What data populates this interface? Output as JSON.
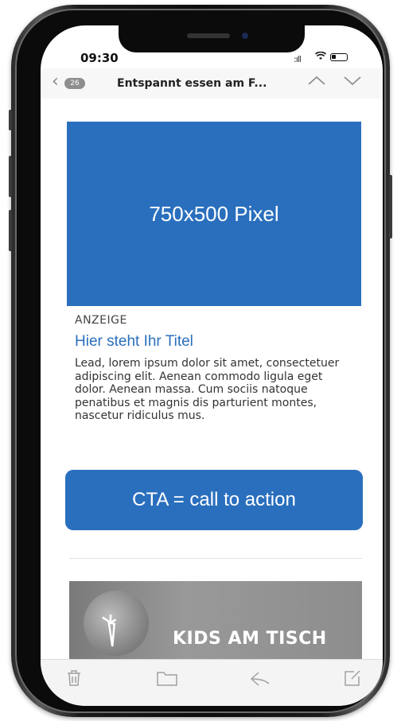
{
  "status": {
    "time": "09:30",
    "signal": ":ıll"
  },
  "nav": {
    "unread_count": "26",
    "subject": "Entspannt essen am F..."
  },
  "ad": {
    "image_label": "750x500 Pixel",
    "label": "ANZEIGE",
    "title": "Hier steht Ihr Titel",
    "body": "Lead, lorem ipsum dolor sit amet, consectetuer adipiscing elit. Aenean commodo ligula eget dolor. Aenean massa. Cum sociis natoque penatibus et magnis dis parturient montes, nascetur ridiculus mus.",
    "cta": "CTA = call to action"
  },
  "banner": {
    "text": "KIDS AM TISCH"
  },
  "icons": {
    "back": "chevron-left-icon",
    "up": "chevron-up-icon",
    "down": "chevron-down-icon",
    "toolbar": [
      "trash-icon",
      "folder-icon",
      "reply-icon",
      "compose-icon"
    ]
  },
  "colors": {
    "accent": "#2a6fbd"
  }
}
